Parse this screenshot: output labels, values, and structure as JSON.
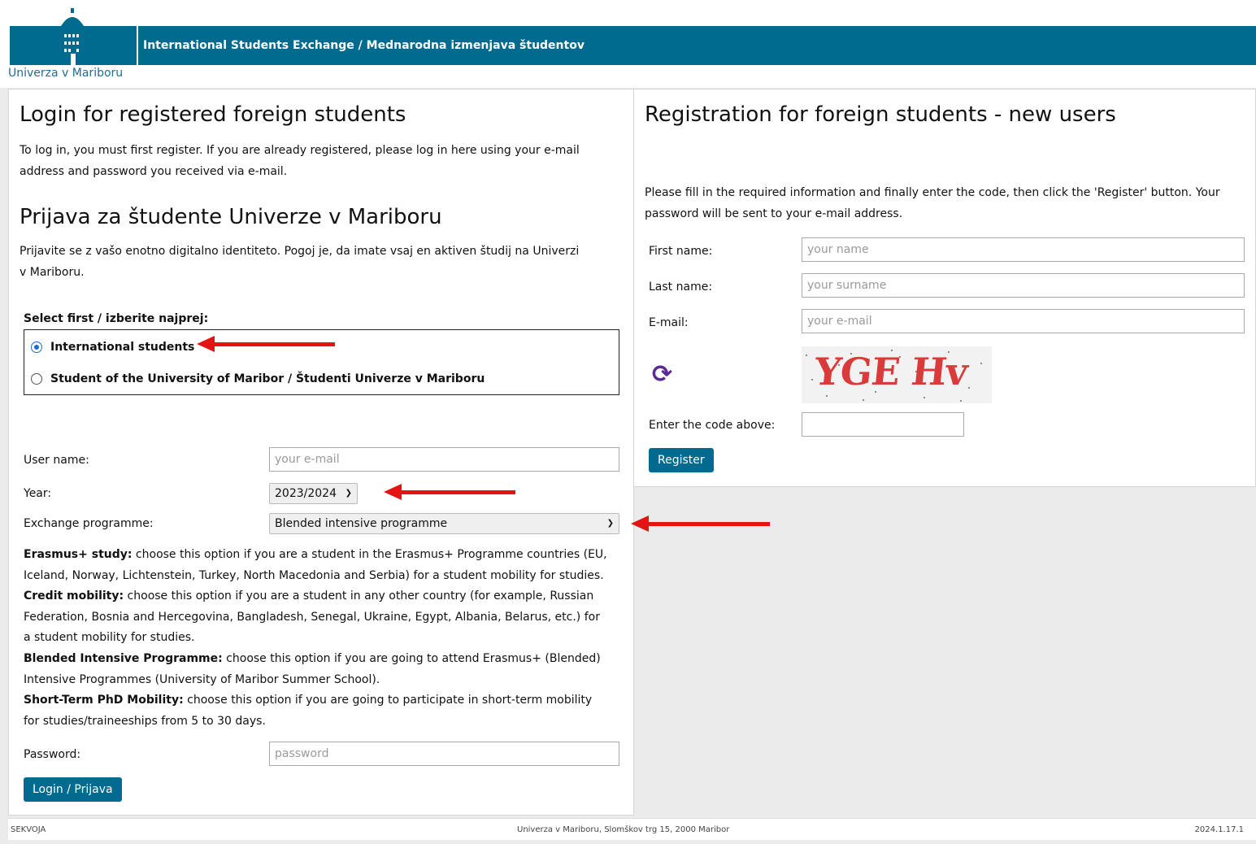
{
  "header": {
    "university_name": "Univerza v Mariboru",
    "title": "International Students Exchange / Mednarodna izmenjava študentov",
    "brand_color": "#006b8e"
  },
  "login": {
    "heading": "Login for registered foreign students",
    "intro": "To log in, you must first register. If you are already registered, please log in here using your e-mail address and password you received via e-mail.",
    "heading_si": "Prijava za študente Univerze v Mariboru",
    "intro_si": "Prijavite se z vašo enotno digitalno identiteto. Pogoj je, da imate vsaj en aktiven študij na Univerzi v Mariboru.",
    "select_label": "Select first / izberite najprej:",
    "options": [
      {
        "label": "International students",
        "selected": true
      },
      {
        "label": "Student of the University of Maribor / Študenti Univerze v Mariboru",
        "selected": false
      }
    ],
    "username_label": "User name:",
    "username_placeholder": "your e-mail",
    "year_label": "Year:",
    "year_value": "2023/2024",
    "programme_label": "Exchange programme:",
    "programme_value": "Blended intensive programme",
    "descriptions": [
      {
        "term": "Erasmus+ study:",
        "text": " choose this option if you are a student in the Erasmus+ Programme countries (EU, Iceland, Norway, Lichtenstein, Turkey, North Macedonia and Serbia) for a student mobility for studies."
      },
      {
        "term": "Credit mobility:",
        "text": " choose this option if you are a student in any other country (for example, Russian Federation, Bosnia and Hercegovina, Bangladesh, Senegal, Ukraine, Egypt, Albania, Belarus, etc.) for a student mobility for studies."
      },
      {
        "term": "Blended Intensive Programme:",
        "text": " choose this option if you are going to attend Erasmus+ (Blended) Intensive Programmes (University of Maribor Summer School)."
      },
      {
        "term": "Short-Term PhD Mobility:",
        "text": " choose this option if you are going to participate in short-term mobility for studies/traineeships from 5 to 30 days."
      }
    ],
    "password_label": "Password:",
    "password_placeholder": "password",
    "login_button": "Login / Prijava"
  },
  "registration": {
    "heading": "Registration for foreign students - new users",
    "intro": "Please fill in the required information and finally enter the code, then click the 'Register' button. Your password will be sent to your e-mail address.",
    "first_name_label": "First name:",
    "first_name_placeholder": "your name",
    "last_name_label": "Last name:",
    "last_name_placeholder": "your surname",
    "email_label": "E-mail:",
    "email_placeholder": "your e-mail",
    "captcha_text": "YGE Hv",
    "refresh_icon": "refresh-icon",
    "code_label": "Enter the code above:",
    "register_button": "Register"
  },
  "footer": {
    "left": "SEKVOJA",
    "center": "Univerza v Mariboru, Slomškov trg 15, 2000 Maribor",
    "right": "2024.1.17.1"
  }
}
